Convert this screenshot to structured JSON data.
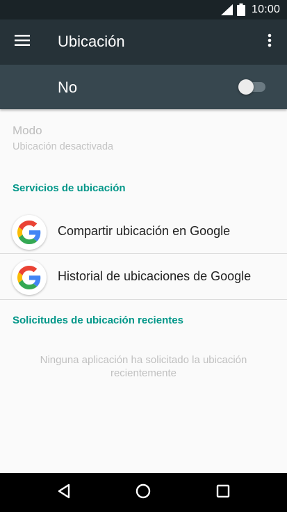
{
  "status_bar": {
    "time": "10:00",
    "signal_icon": "signal-icon",
    "battery_icon": "battery-icon"
  },
  "app_bar": {
    "title": "Ubicación",
    "menu_icon": "menu-icon",
    "more_icon": "more-vert-icon"
  },
  "master_switch": {
    "label": "No",
    "state": "off"
  },
  "mode": {
    "title": "Modo",
    "summary": "Ubicación desactivada"
  },
  "location_services": {
    "header": "Servicios de ubicación",
    "items": [
      {
        "label": "Compartir ubicación en Google",
        "icon": "google-icon"
      },
      {
        "label": "Historial de ubicaciones de Google",
        "icon": "google-icon"
      }
    ]
  },
  "recent_requests": {
    "header": "Solicitudes de ubicación recientes",
    "empty_message": "Ninguna aplicación ha solicitado la ubicación recientemente"
  },
  "nav_bar": {
    "back_icon": "back-icon",
    "home_icon": "home-icon",
    "recents_icon": "recents-icon"
  },
  "colors": {
    "status_bar": "#1a2327",
    "app_bar": "#263238",
    "switch_bar": "#37474f",
    "accent": "#009688"
  }
}
